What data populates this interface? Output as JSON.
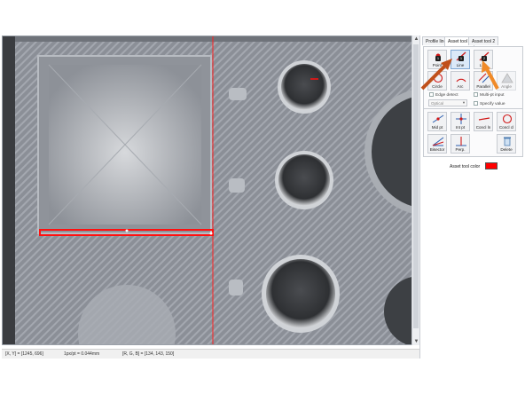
{
  "tabs": [
    {
      "label": "Profile line",
      "active": false
    },
    {
      "label": "Asset tool 1",
      "active": true
    },
    {
      "label": "Asset tool 2",
      "active": false
    }
  ],
  "tools_row1": [
    {
      "name": "point",
      "label": "Point",
      "badge": "1",
      "selected": false,
      "icon": "point-icon"
    },
    {
      "name": "line",
      "label": "Line",
      "badge": "1",
      "selected": true,
      "icon": "line-icon"
    },
    {
      "name": "line2",
      "label": "Line",
      "badge": "2",
      "selected": false,
      "icon": "line-icon"
    }
  ],
  "tools_row2": [
    {
      "name": "circle",
      "label": "Circle",
      "icon": "circle-icon"
    },
    {
      "name": "arc",
      "label": "Arc",
      "icon": "arc-icon"
    },
    {
      "name": "parallel",
      "label": "Parallel",
      "icon": "parallel-icon"
    },
    {
      "name": "angle",
      "label": "Angle",
      "icon": "angle-icon"
    }
  ],
  "options": {
    "edge_detect": "Edge detect",
    "multi_pt_input": "Multi-pt input",
    "specify_value": "Specify value",
    "optical_placeholder": "Optical"
  },
  "tools_row3": [
    {
      "name": "mid-pt",
      "label": "Mid pt",
      "icon": "midpoint-icon"
    },
    {
      "name": "int-pt",
      "label": "Int pt",
      "icon": "intersection-icon"
    },
    {
      "name": "concl-ln",
      "label": "Concl ln",
      "icon": "concl-line-icon"
    },
    {
      "name": "concl-cl",
      "label": "Concl cl",
      "icon": "concl-circle-icon"
    }
  ],
  "tools_row4": [
    {
      "name": "bisector",
      "label": "Bisector",
      "icon": "bisector-icon"
    },
    {
      "name": "perp",
      "label": "Perp.",
      "icon": "perpendicular-icon"
    },
    {
      "name": "delete",
      "label": "Delete",
      "icon": "trash-icon"
    }
  ],
  "asset_tool_color": {
    "label": "Asset tool color",
    "value": "#ff0000"
  },
  "status": {
    "xy": "[X, Y] = [1245, 696]",
    "pixel": "1px/pt = 0.044mm",
    "rgb": "[R, G, B] = [134, 143, 150]"
  },
  "colors": {
    "accent_red": "#ff1010",
    "annotation_orange": "#f07a1a",
    "panel_border": "#c8ccd2"
  }
}
